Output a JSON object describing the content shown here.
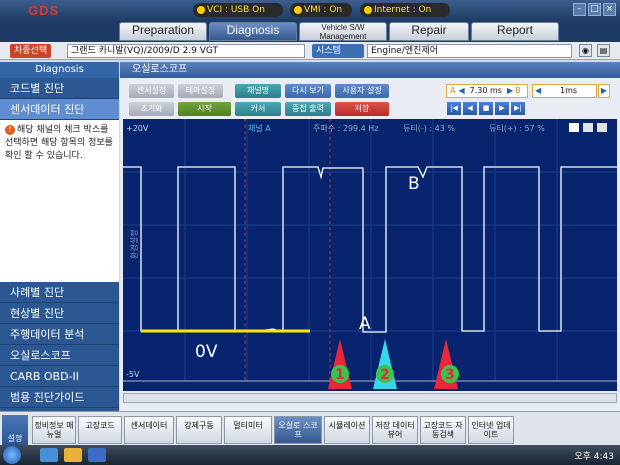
{
  "app": {
    "logo": "GDS"
  },
  "status": {
    "vci": "VCI : USB On",
    "vmi": "VMI : On",
    "internet": "Internet : On"
  },
  "nav_tabs": [
    "Preparation",
    "Diagnosis",
    "Vehicle S/W Management",
    "Repair",
    "Report"
  ],
  "vehicle": {
    "select_label": "차종선택",
    "value": "그랜드 카니발(VQ)/2009/D 2.9 VGT",
    "system_label": "시스템",
    "system_value": "Engine/엔진제어"
  },
  "sidebar": {
    "header": "Diagnosis",
    "items_top": [
      "코드별 진단",
      "센서데이터 진단"
    ],
    "info": "해당 채널의 체크 박스를 선택하면 해당 항목의 정보를 확인 할 수 있습니다.",
    "items_bottom": [
      "사례별 진단",
      "현상별 진단",
      "주행데이터 분석",
      "오실로스코프",
      "CARB OBD-II",
      "범용 진단가이드"
    ]
  },
  "panel": {
    "title": "오실로스코프"
  },
  "toolbar": {
    "sensor_setting": "센서설정",
    "theme_setting": "테마설정",
    "channel": "채널명",
    "replay": "다시 보기",
    "user_setting": "사용자 설정",
    "reset": "초기화",
    "start": "시작",
    "cursor": "커서",
    "overlay_print": "중첩 출력",
    "save": "저장",
    "a_label": "A",
    "time": "7.30 ms",
    "b_label": "B",
    "time_div": "1ms"
  },
  "playback": [
    "|◀",
    "◀",
    "■",
    "▶",
    "▶|"
  ],
  "scope": {
    "top_voltage": "+20V",
    "bottom_voltage": "-5V",
    "channel_label": "채널 A",
    "frequency": "주파수 : 299.4 Hz",
    "duty_minus": "듀티(-) : 43 %",
    "duty_plus": "듀티(+) : 57 %",
    "y_axis_label": "환경설정",
    "annotation_a": "A",
    "annotation_b": "B",
    "annotation_0v": "0V",
    "markers": [
      "1",
      "2",
      "3"
    ]
  },
  "bottom_buttons": [
    "설정",
    "정비정보 매뉴얼",
    "고장코드",
    "센서데이터",
    "강제구동",
    "멀티미터",
    "오실로 스코프",
    "시뮬레이션",
    "저장 데이터 뷰어",
    "고장코드 자동검색",
    "인터넷 업데이트"
  ],
  "taskbar": {
    "clock": "오후 4:43"
  },
  "colors": {
    "scope_bg": "#08246e",
    "trace": "#ffffff",
    "zero_line": "#ffe500",
    "marker_red": "#e8283a",
    "marker_cyan": "#36d7e8"
  }
}
